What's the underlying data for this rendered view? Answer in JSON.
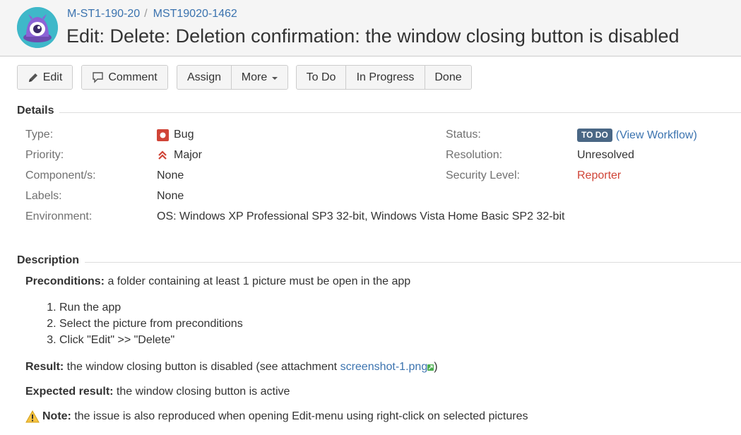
{
  "header": {
    "project_key": "M-ST1-190-20",
    "issue_key": "MST19020-1462",
    "separator": "/",
    "title": "Edit: Delete: Deletion confirmation: the window closing button is disabled"
  },
  "toolbar": {
    "edit_label": "Edit",
    "comment_label": "Comment",
    "assign_label": "Assign",
    "more_label": "More",
    "todo_label": "To Do",
    "inprogress_label": "In Progress",
    "done_label": "Done"
  },
  "details": {
    "heading": "Details",
    "type_label": "Type:",
    "type_value": "Bug",
    "priority_label": "Priority:",
    "priority_value": "Major",
    "components_label": "Component/s:",
    "components_value": "None",
    "labels_label": "Labels:",
    "labels_value": "None",
    "environment_label": "Environment:",
    "environment_value": "OS: Windows XP Professional SP3 32-bit, Windows Vista Home Basic SP2 32-bit",
    "status_label": "Status:",
    "status_value": "TO DO",
    "view_workflow_open": "(",
    "view_workflow": "View Workflow",
    "view_workflow_close": ")",
    "resolution_label": "Resolution:",
    "resolution_value": "Unresolved",
    "security_label": "Security Level:",
    "security_value": "Reporter"
  },
  "description": {
    "heading": "Description",
    "preconditions_label": "Preconditions:",
    "preconditions_text": " a folder containing at least 1 picture must be open in the app",
    "steps": [
      "Run the app",
      "Select the picture from preconditions",
      "Click \"Edit\" >> \"Delete\""
    ],
    "result_label": "Result:",
    "result_text": " the window closing button is disabled (see attachment ",
    "result_link": "screenshot-1.png",
    "result_close": ")",
    "expected_label": "Expected result:",
    "expected_text": " the window closing button is active",
    "note_label": "Note:",
    "note_text": " the issue is also reproduced when opening Edit-menu using right-click on selected pictures"
  },
  "colors": {
    "link": "#3b73af",
    "status_lozenge": "#4a6785",
    "bug_red": "#d04437",
    "header_bg": "#f5f5f5"
  }
}
